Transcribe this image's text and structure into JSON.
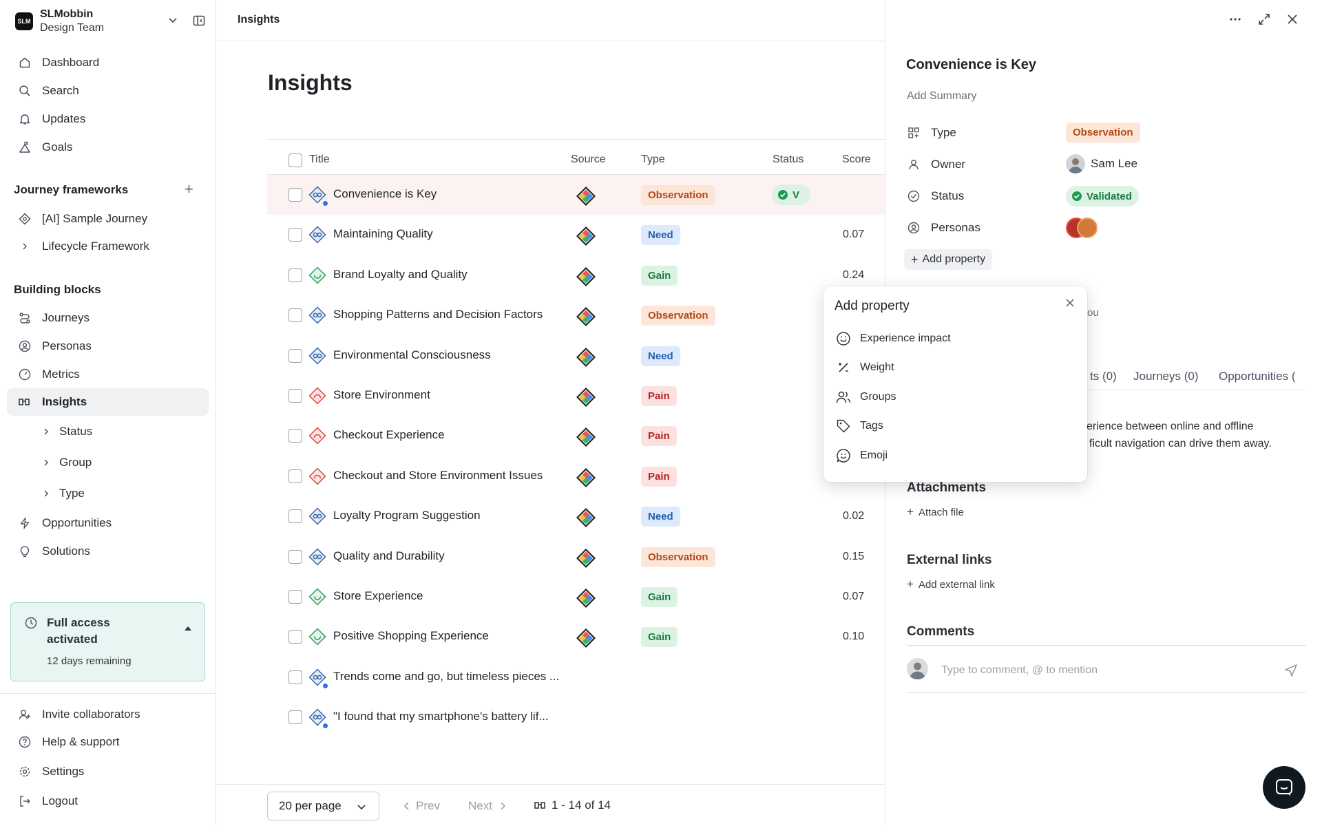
{
  "workspace": {
    "logo_text": "SLM",
    "name": "SLMobbin",
    "team": "Design Team"
  },
  "nav": {
    "dashboard": "Dashboard",
    "search": "Search",
    "updates": "Updates",
    "goals": "Goals"
  },
  "journey_frameworks": {
    "title": "Journey frameworks",
    "items": [
      "[AI] Sample Journey",
      "Lifecycle Framework"
    ]
  },
  "building_blocks": {
    "title": "Building blocks",
    "journeys": "Journeys",
    "personas": "Personas",
    "metrics": "Metrics",
    "insights": "Insights",
    "insights_sub": [
      "Status",
      "Group",
      "Type"
    ],
    "opportunities": "Opportunities",
    "solutions": "Solutions"
  },
  "trial": {
    "title": "Full access activated",
    "remaining": "12 days remaining"
  },
  "bottom_nav": {
    "invite": "Invite collaborators",
    "help": "Help & support",
    "settings": "Settings",
    "logout": "Logout"
  },
  "main": {
    "breadcrumb": "Insights",
    "title": "Insights",
    "columns": [
      "Title",
      "Source",
      "Type",
      "Status",
      "Score"
    ],
    "rows": [
      {
        "title": "Convenience is Key",
        "type": "Observation",
        "score": "",
        "kind": "observation",
        "status": "V",
        "dot": true
      },
      {
        "title": "Maintaining Quality",
        "type": "Need",
        "score": "0.07",
        "kind": "need"
      },
      {
        "title": "Brand Loyalty and Quality",
        "type": "Gain",
        "score": "0.24",
        "kind": "gain"
      },
      {
        "title": "Shopping Patterns and Decision Factors",
        "type": "Observation",
        "score": "",
        "kind": "observation"
      },
      {
        "title": "Environmental Consciousness",
        "type": "Need",
        "score": "",
        "kind": "need"
      },
      {
        "title": "Store Environment",
        "type": "Pain",
        "score": "",
        "kind": "pain"
      },
      {
        "title": "Checkout Experience",
        "type": "Pain",
        "score": "",
        "kind": "pain"
      },
      {
        "title": "Checkout and Store Environment Issues",
        "type": "Pain",
        "score": "",
        "kind": "pain"
      },
      {
        "title": "Loyalty Program Suggestion",
        "type": "Need",
        "score": "0.02",
        "kind": "need"
      },
      {
        "title": "Quality and Durability",
        "type": "Observation",
        "score": "0.15",
        "kind": "observation"
      },
      {
        "title": "Store Experience",
        "type": "Gain",
        "score": "0.07",
        "kind": "gain"
      },
      {
        "title": "Positive Shopping Experience",
        "type": "Gain",
        "score": "0.10",
        "kind": "gain"
      },
      {
        "title": "Trends come and go, but timeless pieces ...",
        "type": "",
        "score": "",
        "kind": "observation",
        "dot": true
      },
      {
        "title": "\"I found that my smartphone's battery lif...",
        "type": "",
        "score": "",
        "kind": "observation",
        "dot": true
      }
    ],
    "per_page": "20 per page",
    "prev": "Prev",
    "next": "Next",
    "count": "1 - 14 of 14"
  },
  "panel": {
    "title": "Convenience is Key",
    "summary_placeholder": "Add Summary",
    "props": {
      "type_label": "Type",
      "type_value": "Observation",
      "owner_label": "Owner",
      "owner_value": "Sam Lee",
      "status_label": "Status",
      "status_value": "Validated",
      "personas_label": "Personas"
    },
    "add_property": "Add property",
    "hidden_fragment": "ou",
    "tabs": [
      "ts (0)",
      "Journeys (0)",
      "Opportunities ("
    ],
    "desc_line1": "erience between online and offline",
    "desc_line2": "ficult navigation can drive them away.",
    "attachments_title": "Attachments",
    "attach_file": "Attach file",
    "external_links_title": "External links",
    "add_external_link": "Add external link",
    "comments_title": "Comments",
    "comment_placeholder": "Type to comment, @ to mention"
  },
  "popup": {
    "title": "Add property",
    "options": [
      "Experience impact",
      "Weight",
      "Groups",
      "Tags",
      "Emoji"
    ]
  },
  "colors": {
    "observation": "#b04a16",
    "need": "#1f5fb0",
    "gain": "#1c7a43",
    "pain": "#b42323",
    "trial_bg": "#e8f5f3"
  }
}
